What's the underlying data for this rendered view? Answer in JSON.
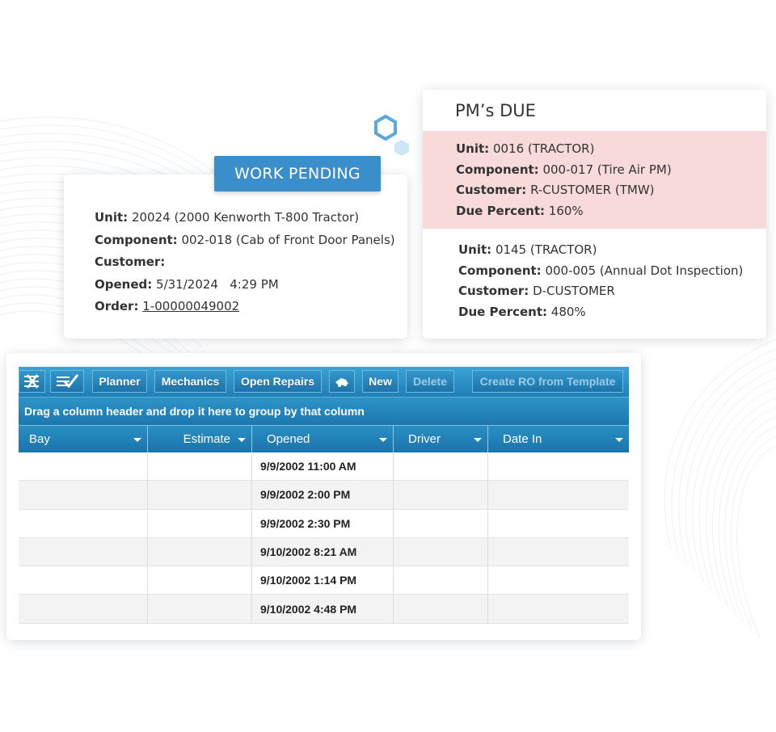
{
  "work_pending": {
    "banner": "WORK PENDING",
    "unit_label": "Unit:",
    "unit_value": "20024 (2000 Kenworth T-800 Tractor)",
    "component_label": "Component:",
    "component_value": "002-018 (Cab of Front Door Panels)",
    "customer_label": "Customer:",
    "customer_value": "",
    "opened_label": "Opened:",
    "opened_value": "5/31/2024   4:29 PM",
    "order_label": "Order:",
    "order_value": "1-00000049002"
  },
  "pms_due": {
    "title": "PM’s DUE",
    "items": [
      {
        "unit_label": "Unit:",
        "unit_value": "0016 (TRACTOR)",
        "component_label": "Component:",
        "component_value": "000-017 (Tire Air PM)",
        "customer_label": "Customer:",
        "customer_value": "R-CUSTOMER (TMW)",
        "due_label": "Due Percent:",
        "due_value": "160%",
        "highlight_color": "#f8dada"
      },
      {
        "unit_label": "Unit:",
        "unit_value": "0145 (TRACTOR)",
        "component_label": "Component:",
        "component_value": "000-005 (Annual Dot Inspection)",
        "customer_label": "Customer:",
        "customer_value": "D-CUSTOMER",
        "due_label": "Due Percent:",
        "due_value": "480%"
      }
    ]
  },
  "grid": {
    "toolbar": {
      "icon_export": "excel-export-icon",
      "icon_checklist": "checklist-icon",
      "planner": "Planner",
      "mechanics": "Mechanics",
      "open_repairs": "Open Repairs",
      "icon_truck": "truck-icon",
      "new": "New",
      "delete": "Delete",
      "create_ro": "Create RO from Template"
    },
    "group_hint": "Drag a column header and drop it here to group by that column",
    "columns": [
      "Bay",
      "Estimate",
      "Opened",
      "Driver",
      "Date In"
    ],
    "rows": [
      {
        "bay": "",
        "estimate": "",
        "opened": "9/9/2002 11:00 AM",
        "driver": "",
        "date_in": ""
      },
      {
        "bay": "",
        "estimate": "",
        "opened": "9/9/2002 2:00 PM",
        "driver": "",
        "date_in": ""
      },
      {
        "bay": "",
        "estimate": "",
        "opened": "9/9/2002 2:30 PM",
        "driver": "",
        "date_in": ""
      },
      {
        "bay": "",
        "estimate": "",
        "opened": "9/10/2002 8:21 AM",
        "driver": "",
        "date_in": ""
      },
      {
        "bay": "",
        "estimate": "",
        "opened": "9/10/2002 1:14 PM",
        "driver": "",
        "date_in": ""
      },
      {
        "bay": "",
        "estimate": "",
        "opened": "9/10/2002 4:48 PM",
        "driver": "",
        "date_in": ""
      }
    ]
  },
  "colors": {
    "accent": "#3a8fcb",
    "toolbar_blue": "#1f7fb6",
    "highlight": "#f8dada"
  }
}
